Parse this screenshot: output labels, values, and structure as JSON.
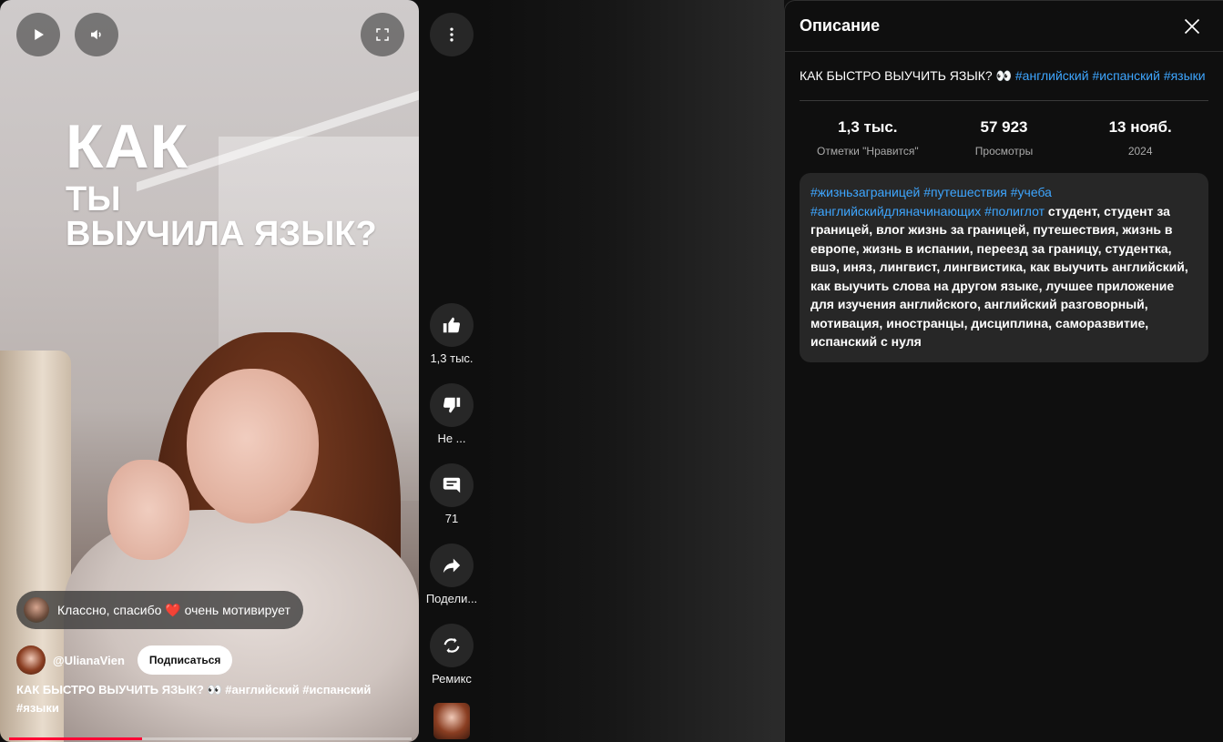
{
  "video": {
    "overlay_lines": [
      "КАК",
      "ТЫ",
      "ВЫУЧИЛА ЯЗЫК?"
    ],
    "comment": "Классно, спасибо ❤️ очень мотивирует",
    "channel_handle": "@UlianaVien",
    "subscribe_label": "Подписаться",
    "title_text": "КАК БЫСТРО ВЫУЧИТЬ ЯЗЫК? 👀",
    "title_hashtags": "#английский #испанский #языки",
    "progress_fraction": 0.33
  },
  "actions": {
    "like_count": "1,3 тыс.",
    "dislike_label": "Не ...",
    "comments_count": "71",
    "share_label": "Подели...",
    "remix_label": "Ремикс"
  },
  "panel": {
    "title": "Описание",
    "video_title": "КАК БЫСТРО ВЫУЧИТЬ ЯЗЫК? 👀",
    "video_hashtags": "#английский #испанский #языки",
    "stats": [
      {
        "value": "1,3 тыс.",
        "label": "Отметки \"Нравится\""
      },
      {
        "value": "57 923",
        "label": "Просмотры"
      },
      {
        "value": "13 нояб.",
        "label": "2024"
      }
    ],
    "desc_hashtags": "#жизньзаграницей #путешествия #учеба #английскийдляначинающих #полиглот",
    "desc_text": "студент, студент за границей, влог жизнь за границей, путешествия, жизнь в европе, жизнь в испании, переезд за границу, студентка, вшэ, иняз, лингвист, лингвистика, как выучить английский, как выучить слова на другом языке, лучшее приложение для изучения английского, английский разговорный, мотивация, иностранцы, дисциплина, саморазвитие, испанский с нуля"
  },
  "colors": {
    "background": "#0f0f0f",
    "link": "#3ea6ff",
    "button_bg": "#272727",
    "progress": "#ff0033"
  },
  "icons": [
    "play-icon",
    "volume-icon",
    "fullscreen-icon",
    "more-vert-icon",
    "thumb-up-icon",
    "thumb-down-icon",
    "comment-icon",
    "share-icon",
    "remix-icon",
    "close-icon"
  ]
}
